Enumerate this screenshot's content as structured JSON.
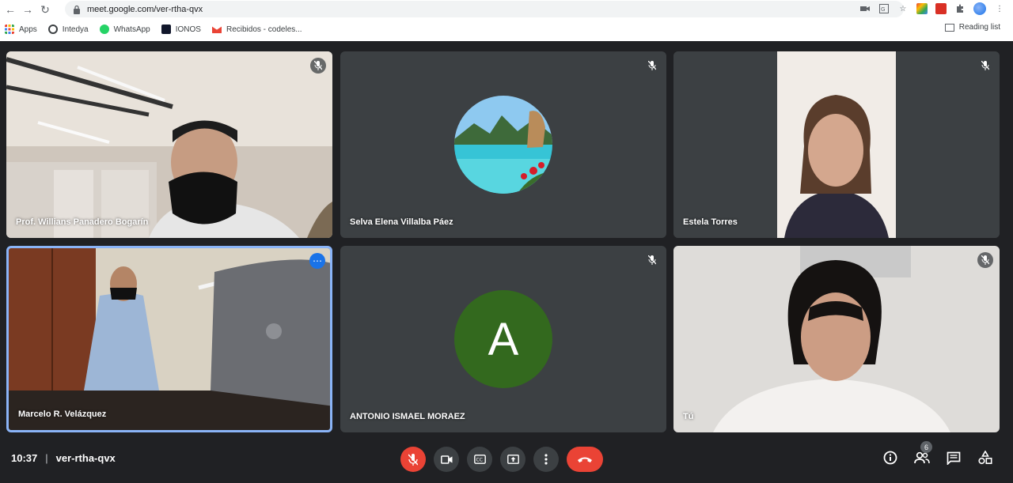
{
  "browser": {
    "url": "meet.google.com/ver-rtha-qvx",
    "bookmarks": [
      {
        "label": "Apps"
      },
      {
        "label": "Intedya"
      },
      {
        "label": "WhatsApp"
      },
      {
        "label": "IONOS"
      },
      {
        "label": "Recibidos - codeles..."
      }
    ],
    "reading_list": "Reading list"
  },
  "participants": [
    {
      "name": "Prof. Willians Panadero Bogarín",
      "muted": true,
      "type": "video"
    },
    {
      "name": "Selva Elena Villalba Páez",
      "muted": true,
      "type": "avatar-image"
    },
    {
      "name": "Estela Torres",
      "muted": true,
      "type": "video"
    },
    {
      "name": "Marcelo R. Velázquez",
      "muted": false,
      "type": "video",
      "active": true
    },
    {
      "name": "ANTONIO ISMAEL MORAEZ",
      "muted": true,
      "type": "avatar-letter",
      "letter": "A",
      "color": "#33691e"
    },
    {
      "name": "Tú",
      "muted": true,
      "type": "video"
    }
  ],
  "meeting": {
    "time": "10:37",
    "separator": "|",
    "code": "ver-rtha-qvx",
    "people_count": "6"
  },
  "colors": {
    "background": "#202124",
    "tile": "#3c4043",
    "end_call": "#ea4335",
    "active_border": "#8ab4f8"
  }
}
